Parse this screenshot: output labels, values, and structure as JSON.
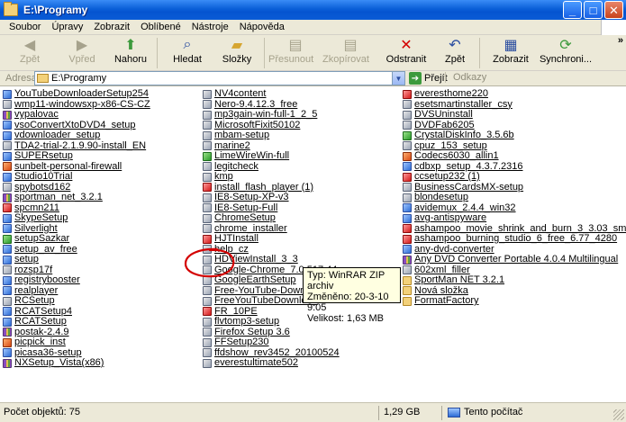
{
  "window": {
    "title": "E:\\Programy"
  },
  "menu": [
    "Soubor",
    "Úpravy",
    "Zobrazit",
    "Oblíbené",
    "Nástroje",
    "Nápověda"
  ],
  "toolbar": [
    {
      "label": "Zpět",
      "icon": "back-arrow-icon",
      "disabled": true
    },
    {
      "label": "Vpřed",
      "icon": "forward-arrow-icon",
      "disabled": true
    },
    {
      "label": "Nahoru",
      "icon": "folder-up-icon",
      "disabled": false
    },
    {
      "label": "Hledat",
      "icon": "search-icon",
      "disabled": false
    },
    {
      "label": "Složky",
      "icon": "folders-icon",
      "disabled": false
    },
    {
      "label": "Přesunout ...",
      "icon": "move-to-icon",
      "disabled": true
    },
    {
      "label": "Zkopírovat ...",
      "icon": "copy-to-icon",
      "disabled": true
    },
    {
      "label": "Odstranit",
      "icon": "delete-icon",
      "disabled": false
    },
    {
      "label": "Zpět",
      "icon": "undo-icon",
      "disabled": false
    },
    {
      "label": "Zobrazit",
      "icon": "views-icon",
      "disabled": false
    },
    {
      "label": "Synchroni...",
      "icon": "sync-icon",
      "disabled": false
    }
  ],
  "toolbar_more": "»",
  "address": {
    "label": "Adresa",
    "path": "E:\\Programy",
    "go_label": "Přejít",
    "links_label": "Odkazy"
  },
  "columns": [
    [
      {
        "name": "YouTubeDownloaderSetup254",
        "type": "exe"
      },
      {
        "name": "wmp11-windowsxp-x86-CS-CZ",
        "type": "msi"
      },
      {
        "name": "vypalovac",
        "type": "zip"
      },
      {
        "name": "vsoConvertXtoDVD4_setup",
        "type": "exe"
      },
      {
        "name": "vdownloader_setup",
        "type": "exe"
      },
      {
        "name": "TDA2-trial-2.1.9.90-install_EN",
        "type": "msi"
      },
      {
        "name": "SUPERsetup",
        "type": "exe"
      },
      {
        "name": "sunbelt-personal-firewall",
        "type": "app"
      },
      {
        "name": "Studio10Trial",
        "type": "exe"
      },
      {
        "name": "spybotsd162",
        "type": "msi"
      },
      {
        "name": "sportman_net_3.2.1",
        "type": "zip"
      },
      {
        "name": "spcmn211",
        "type": "red"
      },
      {
        "name": "SkypeSetup",
        "type": "exe"
      },
      {
        "name": "Silverlight",
        "type": "exe"
      },
      {
        "name": "setupSazkar",
        "type": "grn"
      },
      {
        "name": "setup_av_free",
        "type": "exe"
      },
      {
        "name": "setup",
        "type": "exe"
      },
      {
        "name": "rozsp17f",
        "type": "msi"
      },
      {
        "name": "registrybooster",
        "type": "exe"
      },
      {
        "name": "realplayer",
        "type": "exe"
      },
      {
        "name": "RCSetup",
        "type": "msi"
      },
      {
        "name": "RCATSetup4",
        "type": "exe"
      },
      {
        "name": "RCATSetup",
        "type": "exe"
      },
      {
        "name": "postak-2.4.9",
        "type": "zip"
      },
      {
        "name": "picpick_inst",
        "type": "app"
      },
      {
        "name": "picasa36-setup",
        "type": "exe"
      },
      {
        "name": "NXSetup_Vista(x86)",
        "type": "zip"
      }
    ],
    [
      {
        "name": "NV4content",
        "type": "msi"
      },
      {
        "name": "Nero-9.4.12.3_free",
        "type": "msi"
      },
      {
        "name": "mp3gain-win-full-1_2_5",
        "type": "msi"
      },
      {
        "name": "MicrosoftFixit50102",
        "type": "msi"
      },
      {
        "name": "mbam-setup",
        "type": "msi"
      },
      {
        "name": "marine2",
        "type": "msi"
      },
      {
        "name": "LimeWireWin-full",
        "type": "grn"
      },
      {
        "name": "legitcheck",
        "type": "msi"
      },
      {
        "name": "kmp",
        "type": "msi"
      },
      {
        "name": "install_flash_player (1)",
        "type": "red"
      },
      {
        "name": "IE8-Setup-XP-v3",
        "type": "msi"
      },
      {
        "name": "IE8-Setup-Full",
        "type": "msi"
      },
      {
        "name": "ChromeSetup",
        "type": "msi"
      },
      {
        "name": "chrome_installer",
        "type": "msi"
      },
      {
        "name": "HJTInstall",
        "type": "red"
      },
      {
        "name": "help_cz",
        "type": "msi"
      },
      {
        "name": "HDViewInstall_3_3",
        "type": "msi"
      },
      {
        "name": "Google-Chrome_7.0.517.44",
        "type": "msi"
      },
      {
        "name": "GoogleEarthSetup",
        "type": "msi"
      },
      {
        "name": "Free-YouTube-Download-Convert",
        "type": "msi"
      },
      {
        "name": "FreeYouTubeDownload",
        "type": "msi"
      },
      {
        "name": "FR_10PE",
        "type": "red"
      },
      {
        "name": "flvtomp3-setup",
        "type": "msi"
      },
      {
        "name": "Firefox Setup 3.6",
        "type": "msi"
      },
      {
        "name": "FFSetup230",
        "type": "msi"
      },
      {
        "name": "ffdshow_rev3452_20100524",
        "type": "msi"
      },
      {
        "name": "everestultimate502",
        "type": "msi"
      }
    ],
    [
      {
        "name": "everesthome220",
        "type": "red"
      },
      {
        "name": "esetsmartinstaller_csy",
        "type": "msi"
      },
      {
        "name": "DVSUninstall",
        "type": "msi"
      },
      {
        "name": "DVDFab6205",
        "type": "msi"
      },
      {
        "name": "CrystalDiskInfo_3.5.6b",
        "type": "grn"
      },
      {
        "name": "cpuz_153_setup",
        "type": "msi"
      },
      {
        "name": "Codecs6030_allin1",
        "type": "app"
      },
      {
        "name": "cdbxp_setup_4.3.7.2316",
        "type": "exe"
      },
      {
        "name": "ccsetup232 (1)",
        "type": "red"
      },
      {
        "name": "BusinessCardsMX-setup",
        "type": "msi"
      },
      {
        "name": "blondesetup",
        "type": "msi"
      },
      {
        "name": "avidemux_2.4.4_win32",
        "type": "exe"
      },
      {
        "name": "avg-antispyware",
        "type": "exe"
      },
      {
        "name": "ashampoo_movie_shrink_and_burn_3_3.03_sm",
        "type": "red"
      },
      {
        "name": "ashampoo_burning_studio_6_free_6.77_4280",
        "type": "red"
      },
      {
        "name": "any-dvd-converter",
        "type": "exe"
      },
      {
        "name": "Any DVD Converter Portable 4.0.4 Multilingual",
        "type": "zip"
      },
      {
        "name": "602xml_filler",
        "type": "msi"
      },
      {
        "name": "SportMan NET 3.2.1",
        "type": "folder"
      },
      {
        "name": "Nová složka",
        "type": "folder"
      },
      {
        "name": "FormatFactory",
        "type": "folder"
      }
    ]
  ],
  "tooltip": {
    "type": "Typ: WinRAR ZIP archiv",
    "modified": "Změněno: 20-3-10 9:05",
    "size": "Velikost: 1,63 MB"
  },
  "status": {
    "objects": "Počet objektů: 75",
    "size": "1,29 GB",
    "zone": "Tento počítač"
  },
  "colors": {
    "titlebar": "#0554d0",
    "chrome": "#ece9d8",
    "tooltip": "#ffffe1",
    "annotation": "#d40000"
  }
}
